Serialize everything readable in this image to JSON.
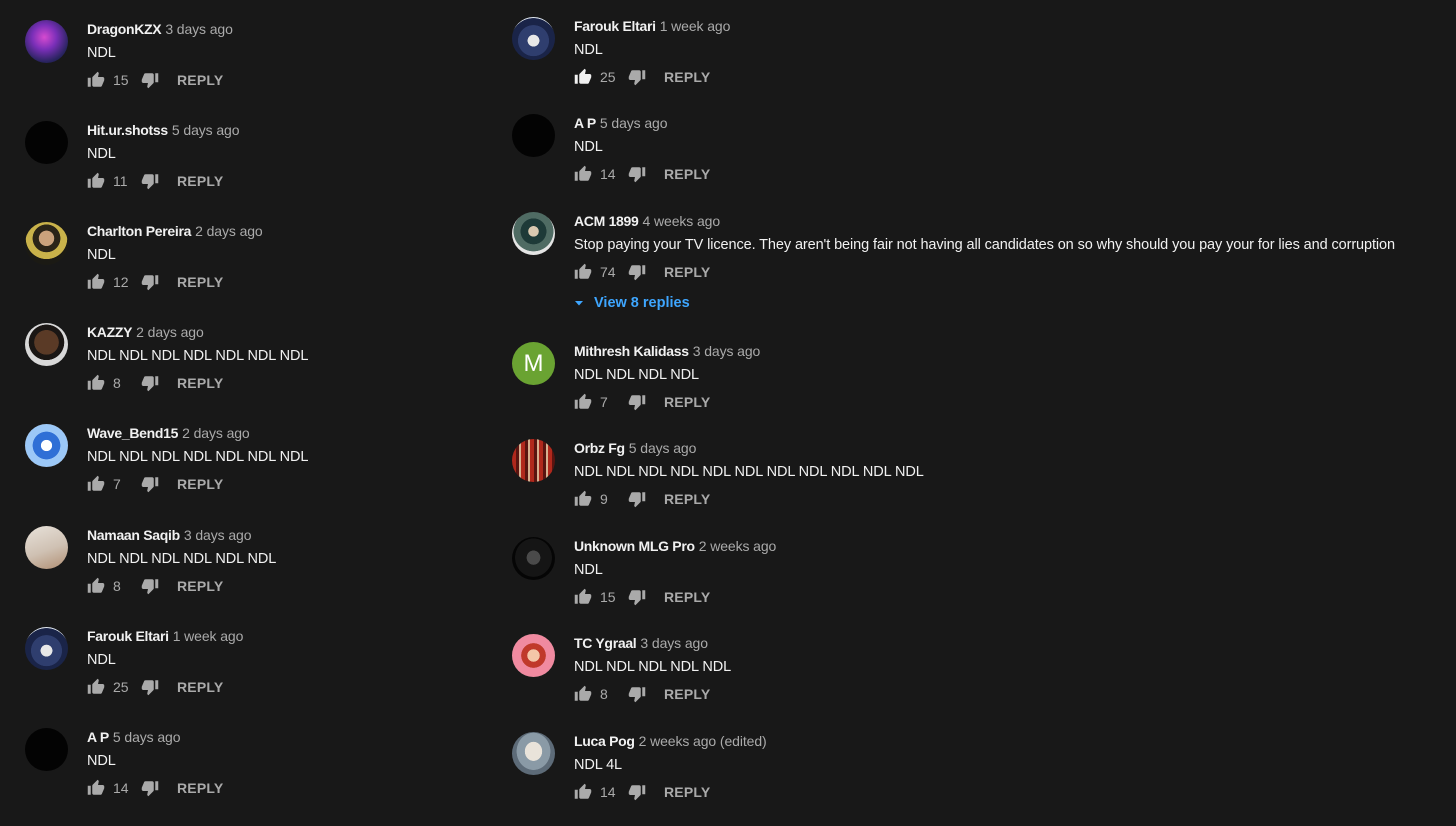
{
  "reply_label": "REPLY",
  "left_comments": [
    {
      "author": "DragonKZX",
      "time": "3 days ago",
      "text": "NDL",
      "likes": "15",
      "avatar": "dragon"
    },
    {
      "author": "Hit.ur.shotss",
      "time": "5 days ago",
      "text": "NDL",
      "likes": "11",
      "avatar": "black"
    },
    {
      "author": "Charlton Pereira",
      "time": "2 days ago",
      "text": "NDL",
      "likes": "12",
      "avatar": "person-yellow"
    },
    {
      "author": "KAZZY",
      "time": "2 days ago",
      "text": "NDL NDL NDL NDL NDL NDL NDL",
      "likes": "8",
      "avatar": "person-dark"
    },
    {
      "author": "Wave_Bend15",
      "time": "2 days ago",
      "text": "NDL NDL NDL NDL NDL NDL NDL",
      "likes": "7",
      "avatar": "blue-emblem"
    },
    {
      "author": "Namaan Saqib",
      "time": "3 days ago",
      "text": "NDL NDL NDL NDL NDL NDL",
      "likes": "8",
      "avatar": "beige"
    },
    {
      "author": "Farouk Eltari",
      "time": "1 week ago",
      "text": "NDL",
      "likes": "25",
      "avatar": "anime-blue"
    },
    {
      "author": "A P",
      "time": "5 days ago",
      "text": "NDL",
      "likes": "14",
      "avatar": "black"
    }
  ],
  "right_comments": [
    {
      "author": "Farouk Eltari",
      "time": "1 week ago",
      "text": "NDL",
      "likes": "25",
      "avatar": "anime-blue",
      "liked": true
    },
    {
      "author": "A P",
      "time": "5 days ago",
      "text": "NDL",
      "likes": "14",
      "avatar": "black"
    },
    {
      "author": "ACM 1899",
      "time": "4 weeks ago",
      "text": "Stop paying your TV licence. They aren't being fair not having all candidates on so why should you pay your for lies and corruption",
      "likes": "74",
      "avatar": "fighter",
      "replies": "View 8 replies"
    },
    {
      "author": "Mithresh Kalidass",
      "time": "3 days ago",
      "text": "NDL NDL NDL NDL",
      "likes": "7",
      "avatar": "letter",
      "letter": "M"
    },
    {
      "author": "Orbz Fg",
      "time": "5 days ago",
      "text": "NDL NDL NDL NDL NDL NDL NDL NDL NDL NDL NDL",
      "likes": "9",
      "avatar": "red-crowd"
    },
    {
      "author": "Unknown MLG Pro",
      "time": "2 weeks ago",
      "text": "NDL",
      "likes": "15",
      "avatar": "mask"
    },
    {
      "author": "TC Ygraal",
      "time": "3 days ago",
      "text": "NDL NDL NDL NDL NDL",
      "likes": "8",
      "avatar": "pink-character"
    },
    {
      "author": "Luca Pog",
      "time": "2 weeks ago (edited)",
      "text": "NDL 4L",
      "likes": "14",
      "avatar": "portrait"
    }
  ],
  "colors": {
    "background": "#181818",
    "link": "#3ea6ff",
    "muted": "#aaaaaa",
    "text": "#f1f1f1",
    "letter_avatar": "#6aa332"
  }
}
